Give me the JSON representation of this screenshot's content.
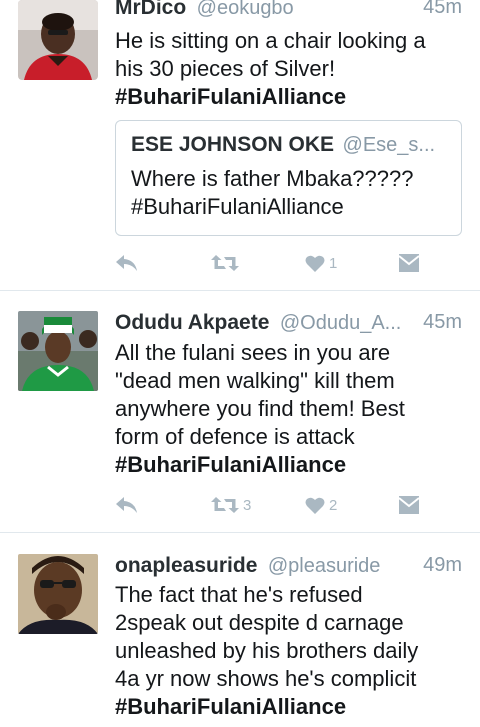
{
  "colors": {
    "action_icon": "#aab8c2",
    "divider": "#e1e8ed",
    "secondary_text": "#8899a6"
  },
  "tweets": [
    {
      "name": "MrDico",
      "handle": "@eokugbo",
      "time": "45m",
      "text_lines": [
        "He is sitting on a chair looking a",
        "his 30 pieces of Silver!"
      ],
      "hashtag": "#BuhariFulaniAlliance",
      "quote": {
        "name": "ESE JOHNSON OKE",
        "handle": "@Ese_s...",
        "text_lines": [
          "Where is father Mbaka?????",
          "#BuhariFulaniAlliance"
        ]
      },
      "retweets": "",
      "likes": "1"
    },
    {
      "name": "Odudu Akpaete",
      "handle": "@Odudu_A...",
      "time": "45m",
      "text_lines": [
        "All the fulani sees in you are",
        "\"dead men walking\" kill them",
        "anywhere you find them! Best",
        "form of defence is attack"
      ],
      "hashtag": "#BuhariFulaniAlliance",
      "retweets": "3",
      "likes": "2"
    },
    {
      "name": "onapleasuride",
      "handle": "@pleasuride",
      "time": "49m",
      "text_lines": [
        "The fact that he's refused",
        "2speak out despite d carnage",
        "unleashed by his brothers daily",
        "4a yr now shows he's complicit"
      ],
      "hashtag": "#BuhariFulaniAlliance"
    }
  ]
}
